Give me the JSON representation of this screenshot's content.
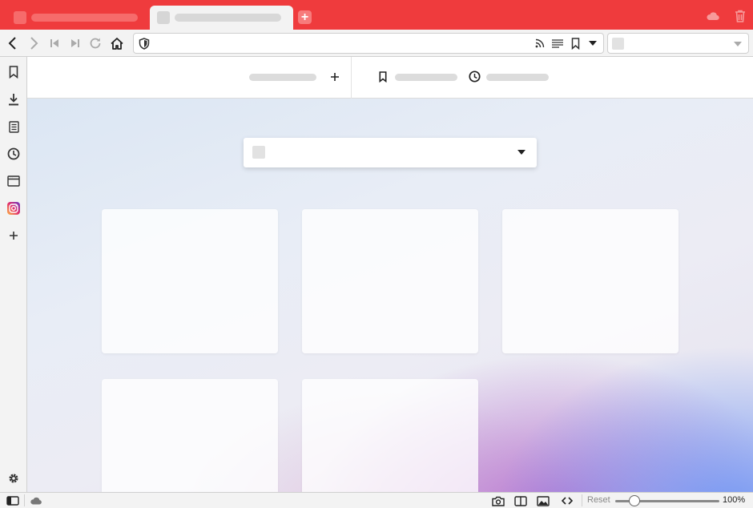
{
  "colors": {
    "tab_bar": "#ef3b3d",
    "chrome_bg": "#f3f3f3",
    "placeholder": "#dcdcdc",
    "icon": "#333333"
  },
  "tabbar": {
    "icons": [
      "tab-favicon",
      "new-tab-plus-icon",
      "cloud-sync-icon",
      "trash-icon"
    ]
  },
  "toolbar": {
    "icons": [
      "back-icon",
      "forward-icon",
      "rewind-icon",
      "fast-forward-icon",
      "reload-icon",
      "home-icon",
      "shield-icon",
      "rss-icon",
      "reader-mode-icon",
      "bookmark-icon",
      "dropdown-icon"
    ]
  },
  "sidebar": {
    "icons": [
      "bookmarks-icon",
      "downloads-icon",
      "notes-icon",
      "history-icon",
      "window-panel-icon",
      "instagram-icon",
      "add-panel-icon",
      "settings-icon"
    ]
  },
  "header": {
    "icons": [
      "add-icon",
      "bookmark-icon",
      "clock-icon"
    ]
  },
  "statusbar": {
    "reset_label": "Reset",
    "zoom_level": "100%",
    "zoom_fraction": 0.15,
    "icons": [
      "panel-toggle-icon",
      "cloud-icon",
      "camera-icon",
      "tiling-icon",
      "image-icon",
      "code-icon"
    ]
  }
}
